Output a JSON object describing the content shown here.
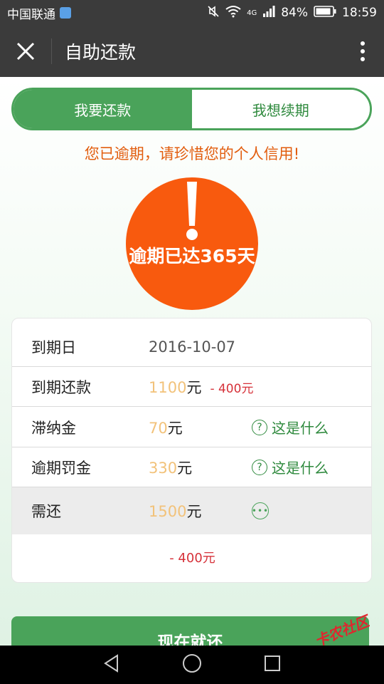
{
  "status_bar": {
    "carrier": "中国联通",
    "network": "4G",
    "battery": "84%",
    "time": "18:59"
  },
  "app_bar": {
    "title": "自助还款"
  },
  "tabs": [
    {
      "label": "我要还款",
      "active": true
    },
    {
      "label": "我想续期",
      "active": false
    }
  ],
  "warning_text": "您已逾期，请珍惜您的个人信用!",
  "overdue_badge": {
    "text": "逾期已达365天",
    "color": "#f85a0e"
  },
  "details": {
    "due_date": {
      "label": "到期日",
      "value": "2016-10-07"
    },
    "due_amount": {
      "label": "到期还款",
      "amount": "1100",
      "unit": "元",
      "deduction": "- 400元"
    },
    "late_fee": {
      "label": "滞纳金",
      "amount": "70",
      "unit": "元",
      "help": "这是什么"
    },
    "overdue_penalty": {
      "label": "逾期罚金",
      "amount": "330",
      "unit": "元",
      "help": "这是什么"
    },
    "total": {
      "label": "需还",
      "amount": "1500",
      "unit": "元"
    },
    "total_deduction": "- 400元"
  },
  "repay_button": "现在就还",
  "watermark": "卡农社区",
  "colors": {
    "accent_green": "#4aa35a",
    "warning_orange": "#e25d0e",
    "amount_gold": "#f2c27a",
    "deduction_red": "#d6323a"
  }
}
